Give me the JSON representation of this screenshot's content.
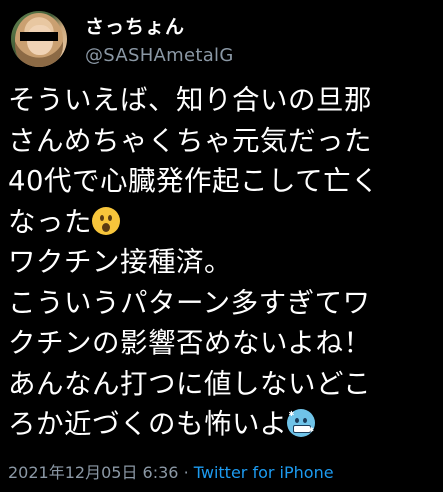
{
  "user": {
    "display_name": "さっちょん",
    "handle": "@SASHAmetalG"
  },
  "more_icon": "ellipsis-icon",
  "tweet": {
    "lines": [
      "そういえば、知り合いの旦那",
      "さんめちゃくちゃ元気だった",
      "40代で心臓発作起こして亡く",
      "なった",
      "ワクチン接種済。",
      "こういうパターン多すぎてワ",
      "クチンの影響否めないよね！",
      "あんなん打つに値しないどこ",
      "ろか近づくのも怖いよ"
    ],
    "emoji_1": "hushed-face-icon",
    "emoji_2": "cold-face-icon"
  },
  "meta": {
    "timestamp": "2021年12月05日 6:36",
    "separator": "·",
    "source": "Twitter for iPhone"
  },
  "colors": {
    "background": "#000000",
    "text": "#ffffff",
    "secondary": "#8b98a5",
    "link": "#1d9bf0"
  }
}
